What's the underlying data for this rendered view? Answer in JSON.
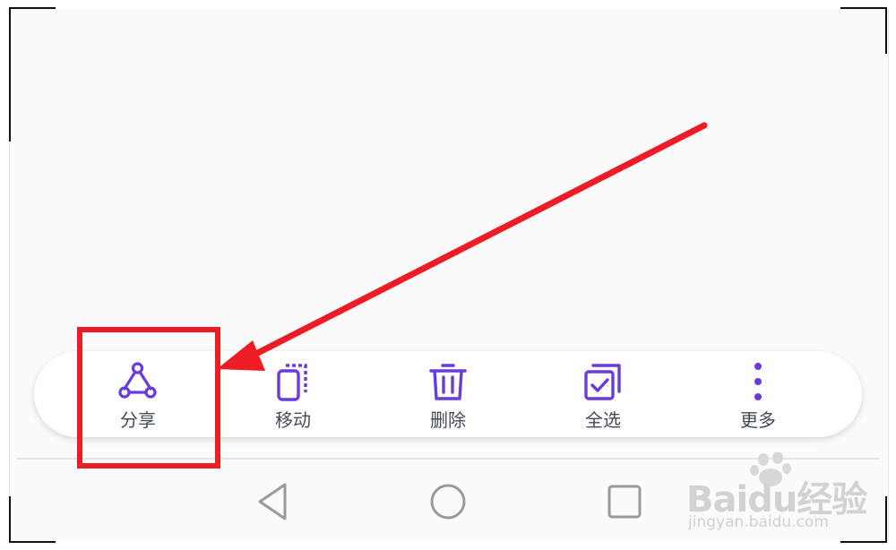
{
  "actions": [
    {
      "label": "分享",
      "icon": "share-icon"
    },
    {
      "label": "移动",
      "icon": "move-icon"
    },
    {
      "label": "删除",
      "icon": "trash-icon"
    },
    {
      "label": "全选",
      "icon": "select-all-icon"
    },
    {
      "label": "更多",
      "icon": "more-vertical-icon"
    }
  ],
  "navigation": {
    "back_icon": "triangle-back-icon",
    "home_icon": "circle-home-icon",
    "recents_icon": "square-recents-icon"
  },
  "watermark": {
    "brand": "Baidu经验",
    "url": "jingyan.baidu.com"
  },
  "colors": {
    "accent": "#6a3bdb",
    "annotation": "#ee1c24",
    "label": "#444a55",
    "nav_icon": "#9a9a9a"
  }
}
